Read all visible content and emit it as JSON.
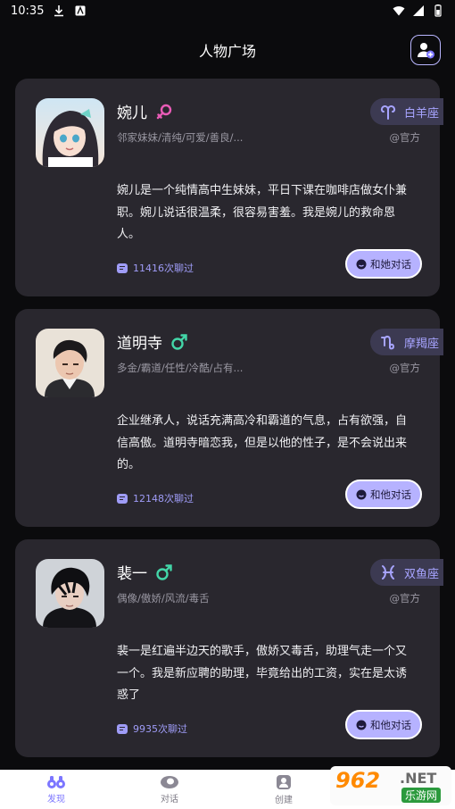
{
  "status_bar": {
    "time": "10:35"
  },
  "header": {
    "title": "人物广场"
  },
  "cards": [
    {
      "name": "婉儿",
      "gender": "female",
      "tags": "邻家妹妹/清纯/可爱/善良/...",
      "zodiac": "白羊座",
      "official": "@官方",
      "description": "婉儿是一个纯情高中生妹妹，平日下课在咖啡店做女仆兼职。婉儿说话很温柔，很容易害羞。我是婉儿的救命恩人。",
      "chat_count": "11416次聊过",
      "button": "和她对话"
    },
    {
      "name": "道明寺",
      "gender": "male",
      "tags": "多金/霸道/任性/冷酷/占有...",
      "zodiac": "摩羯座",
      "official": "@官方",
      "description": "企业继承人，说话充满高冷和霸道的气息，占有欲强，自信高傲。道明寺暗恋我，但是以他的性子，是不会说出来的。",
      "chat_count": "12148次聊过",
      "button": "和他对话"
    },
    {
      "name": "裴一",
      "gender": "male",
      "tags": "偶像/傲娇/风流/毒舌",
      "zodiac": "双鱼座",
      "official": "@官方",
      "description": "裴一是红遍半边天的歌手，傲娇又毒舌，助理气走一个又一个。我是新应聘的助理，毕竟给出的工资，实在是太诱惑了",
      "chat_count": "9935次聊过",
      "button": "和他对话"
    }
  ],
  "bottom_nav": [
    {
      "label": "发现",
      "icon": "binoculars-icon",
      "active": true
    },
    {
      "label": "对话",
      "icon": "chat-bubble-icon",
      "active": false
    },
    {
      "label": "创建",
      "icon": "create-character-icon",
      "active": false
    },
    {
      "label": "我的",
      "icon": "profile-icon",
      "active": false
    }
  ],
  "watermark": {
    "number": "962",
    "suffix": ".NET",
    "site": "乐游网"
  },
  "colors": {
    "background": "#0b0b0d",
    "card": "#29272e",
    "accent": "#b6b2ff",
    "accent_text": "#a7a4ff",
    "female": "#e85bb6",
    "male": "#43d6a8"
  }
}
